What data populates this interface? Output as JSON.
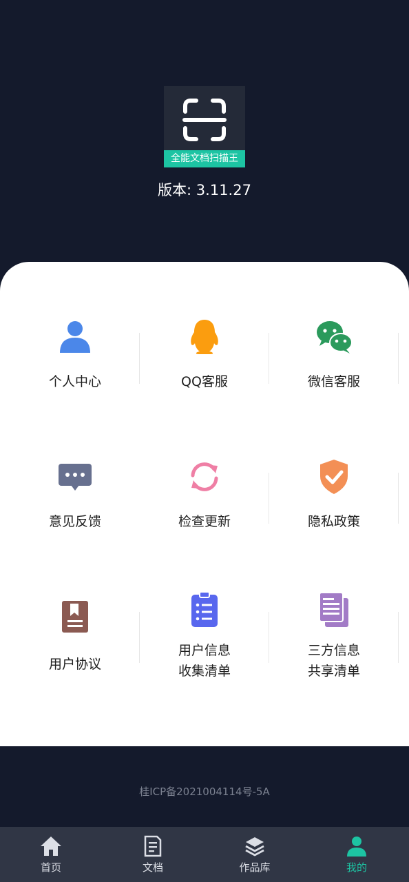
{
  "app": {
    "logo_text": "全能文档扫描王",
    "version": "版本: 3.11.27"
  },
  "grid": [
    {
      "label": "个人中心",
      "icon": "person-icon",
      "color": "#4b87e9"
    },
    {
      "label": "QQ客服",
      "icon": "qq-penguin-icon",
      "color": "#fb9d0f"
    },
    {
      "label": "微信客服",
      "icon": "wechat-icon",
      "color": "#2b9a5c"
    },
    {
      "label": "意见反馈",
      "icon": "feedback-chat-icon",
      "color": "#67708f"
    },
    {
      "label": "检查更新",
      "icon": "refresh-icon",
      "color": "#ef7fa5"
    },
    {
      "label": "隐私政策",
      "icon": "shield-check-icon",
      "color": "#f38f55"
    },
    {
      "label": "用户协议",
      "icon": "agreement-book-icon",
      "color": "#8b5a52"
    },
    {
      "label_line1": "用户信息",
      "label_line2": "收集清单",
      "icon": "clipboard-list-icon",
      "color": "#5867ee"
    },
    {
      "label_line1": "三方信息",
      "label_line2": "共享清单",
      "icon": "documents-icon",
      "color": "#a27bc6"
    }
  ],
  "footer": {
    "icp": "桂ICP备2021004114号-5A"
  },
  "tabbar": [
    {
      "label": "首页",
      "icon": "home-icon",
      "active": false
    },
    {
      "label": "文档",
      "icon": "document-icon",
      "active": false
    },
    {
      "label": "作品库",
      "icon": "layers-icon",
      "active": false
    },
    {
      "label": "我的",
      "icon": "profile-icon",
      "active": true
    }
  ],
  "colors": {
    "background": "#141a2c",
    "accent": "#1dc4a3",
    "tabbar": "#303645"
  }
}
